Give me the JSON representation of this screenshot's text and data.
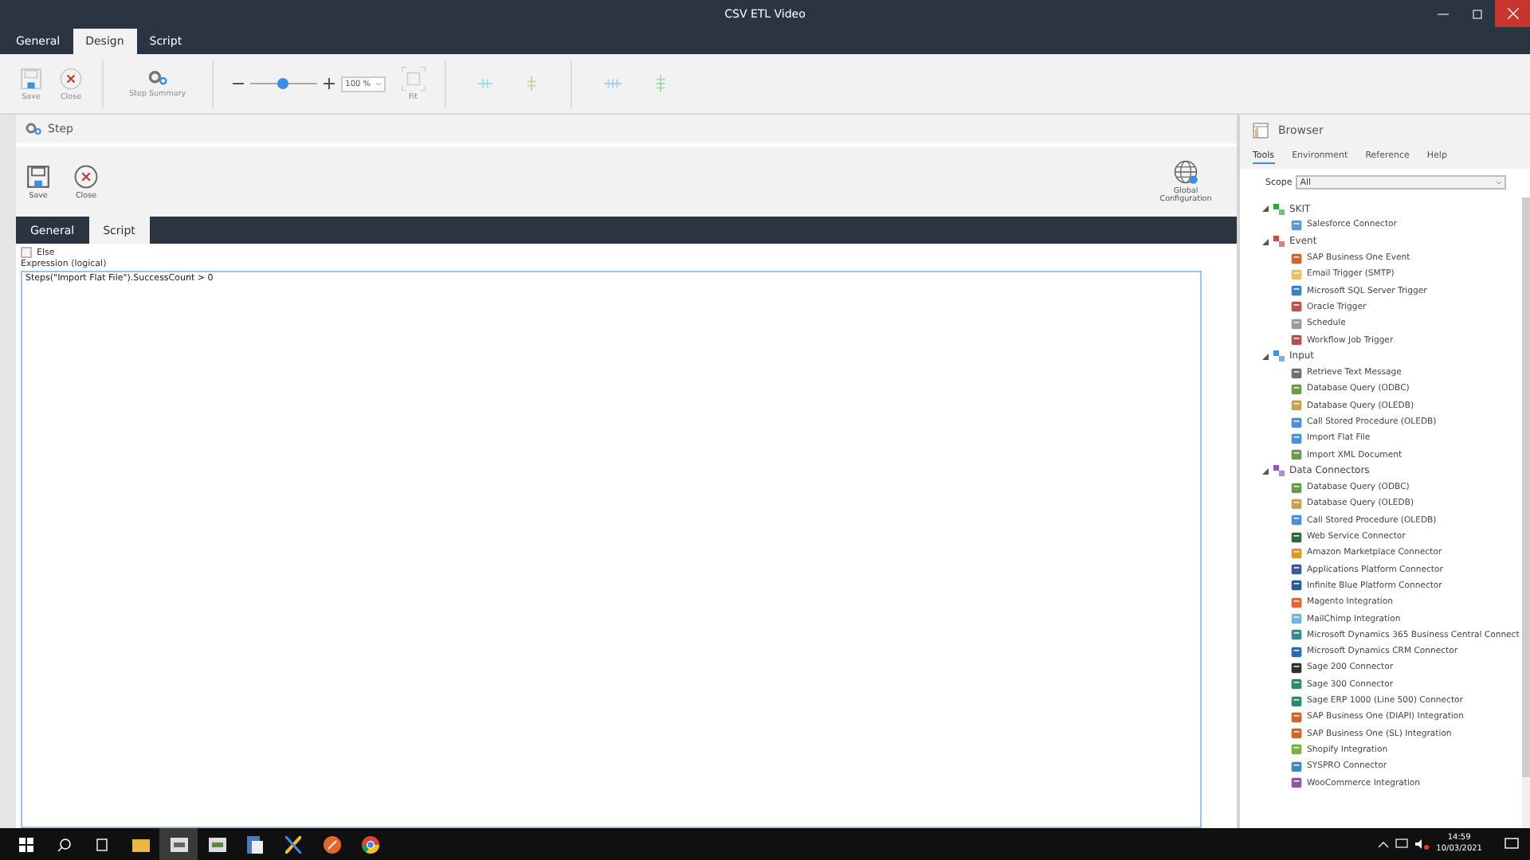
{
  "window": {
    "title": "CSV ETL Video"
  },
  "tabs": [
    {
      "label": "General",
      "selected": false
    },
    {
      "label": "Design",
      "selected": true
    },
    {
      "label": "Script",
      "selected": false
    }
  ],
  "ribbon": {
    "save": "Save",
    "close": "Close",
    "step_summary": "Step Summary",
    "zoom": {
      "level": 0.5,
      "value": "100 %"
    },
    "fit": "Fit"
  },
  "step": {
    "title": "Step",
    "save": "Save",
    "close": "Close",
    "global_configuration": "Global Configuration",
    "tabs": [
      {
        "label": "General",
        "selected": false
      },
      {
        "label": "Script",
        "selected": true
      }
    ],
    "else": {
      "label": "Else",
      "checked": false
    },
    "expression_label": "Expression (logical)",
    "expression": "Steps(\"Import Flat File\").SuccessCount > 0"
  },
  "browser": {
    "title": "Browser",
    "tabs": [
      {
        "label": "Tools",
        "selected": true
      },
      {
        "label": "Environment",
        "selected": false
      },
      {
        "label": "Reference",
        "selected": false
      },
      {
        "label": "Help",
        "selected": false
      }
    ],
    "scope_label": "Scope",
    "scope": "All",
    "tree": [
      {
        "label": "SKIT",
        "expanded": true,
        "color": "#3aa23a",
        "children": [
          {
            "label": "Salesforce Connector",
            "color": "#5a9bd5"
          }
        ]
      },
      {
        "label": "Event",
        "expanded": true,
        "color": "#c0504d",
        "children": [
          {
            "label": "SAP Business One Event",
            "color": "#d0652a"
          },
          {
            "label": "Email Trigger (SMTP)",
            "color": "#e8c060"
          },
          {
            "label": "Microsoft SQL Server Trigger",
            "color": "#3b7fc4"
          },
          {
            "label": "Oracle Trigger",
            "color": "#c0504d"
          },
          {
            "label": "Schedule",
            "color": "#9a9a9a"
          },
          {
            "label": "Workflow Job Trigger",
            "color": "#b05050"
          }
        ]
      },
      {
        "label": "Input",
        "expanded": true,
        "color": "#4a90d9",
        "children": [
          {
            "label": "Retrieve Text Message",
            "color": "#707070"
          },
          {
            "label": "Database Query (ODBC)",
            "color": "#6a9a50"
          },
          {
            "label": "Database Query (OLEDB)",
            "color": "#c8a050"
          },
          {
            "label": "Call Stored Procedure (OLEDB)",
            "color": "#4a90d9"
          },
          {
            "label": "Import Flat File",
            "color": "#4a90d9"
          },
          {
            "label": "Import XML Document",
            "color": "#6a9a50"
          }
        ]
      },
      {
        "label": "Data Connectors",
        "expanded": true,
        "color": "#8a5ac0",
        "children": [
          {
            "label": "Database Query (ODBC)",
            "color": "#6a9a50"
          },
          {
            "label": "Database Query (OLEDB)",
            "color": "#c8a050"
          },
          {
            "label": "Call Stored Procedure (OLEDB)",
            "color": "#4a90d9"
          },
          {
            "label": "Web Service Connector",
            "color": "#2a6a3a"
          },
          {
            "label": "Amazon Marketplace Connector",
            "color": "#e09a20"
          },
          {
            "label": "Applications Platform Connector",
            "color": "#3a5aa0"
          },
          {
            "label": "Infinite Blue Platform Connector",
            "color": "#2a5a9a"
          },
          {
            "label": "Magento Integration",
            "color": "#e8642c"
          },
          {
            "label": "MailChimp Integration",
            "color": "#6ab8e0"
          },
          {
            "label": "Microsoft Dynamics 365 Business Central Connect",
            "color": "#3a8a8a"
          },
          {
            "label": "Microsoft Dynamics CRM Connector",
            "color": "#2a6ab0"
          },
          {
            "label": "Sage 200 Connector",
            "color": "#303030"
          },
          {
            "label": "Sage 300 Connector",
            "color": "#2a8a6a"
          },
          {
            "label": "Sage ERP 1000 (Line 500) Connector",
            "color": "#2a8a6a"
          },
          {
            "label": "SAP Business One (DIAPI) Integration",
            "color": "#d0652a"
          },
          {
            "label": "SAP Business One (SL) Integration",
            "color": "#d0652a"
          },
          {
            "label": "Shopify Integration",
            "color": "#7ab040"
          },
          {
            "label": "SYSPRO Connector",
            "color": "#3a8ac0"
          },
          {
            "label": "WooCommerce Integration",
            "color": "#8a5a9a"
          }
        ]
      }
    ]
  },
  "taskbar": {
    "time": "14:59",
    "date": "10/03/2021"
  }
}
